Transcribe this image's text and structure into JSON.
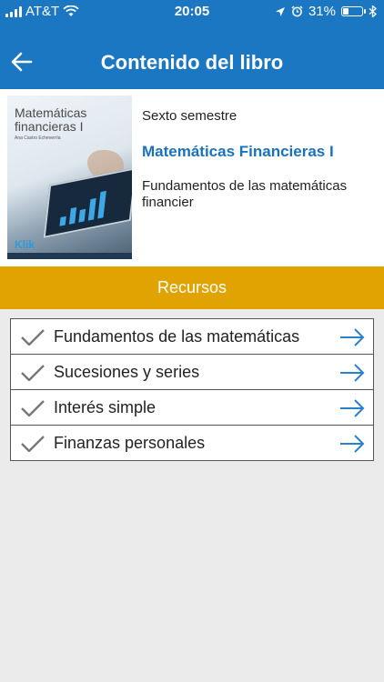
{
  "status_bar": {
    "carrier": "AT&T",
    "time": "20:05",
    "battery_percent": "31%",
    "battery_level": 0.31,
    "icons": [
      "signal-icon",
      "wifi-icon",
      "location-icon",
      "alarm-icon",
      "bluetooth-icon",
      "battery-icon"
    ]
  },
  "header": {
    "title": "Contenido del libro",
    "back_icon": "arrow-left-icon",
    "color": "#1c77c3"
  },
  "book": {
    "cover_title": "Matemáticas financieras I",
    "cover_author": "Ana Castro Echeverría",
    "cover_brand": "Klik",
    "semester": "Sexto semestre",
    "title": "Matemáticas Financieras I",
    "description": "Fundamentos de las matemáticas financier",
    "title_color": "#1a73ba"
  },
  "section": {
    "label": "Recursos",
    "color": "#e1a301"
  },
  "resources": [
    {
      "label": "Fundamentos de las matemáticas",
      "icon": "check-icon",
      "action_icon": "arrow-right-icon"
    },
    {
      "label": "Sucesiones y series",
      "icon": "check-icon",
      "action_icon": "arrow-right-icon"
    },
    {
      "label": "Interés simple",
      "icon": "check-icon",
      "action_icon": "arrow-right-icon"
    },
    {
      "label": "Finanzas personales",
      "icon": "check-icon",
      "action_icon": "arrow-right-icon"
    }
  ]
}
